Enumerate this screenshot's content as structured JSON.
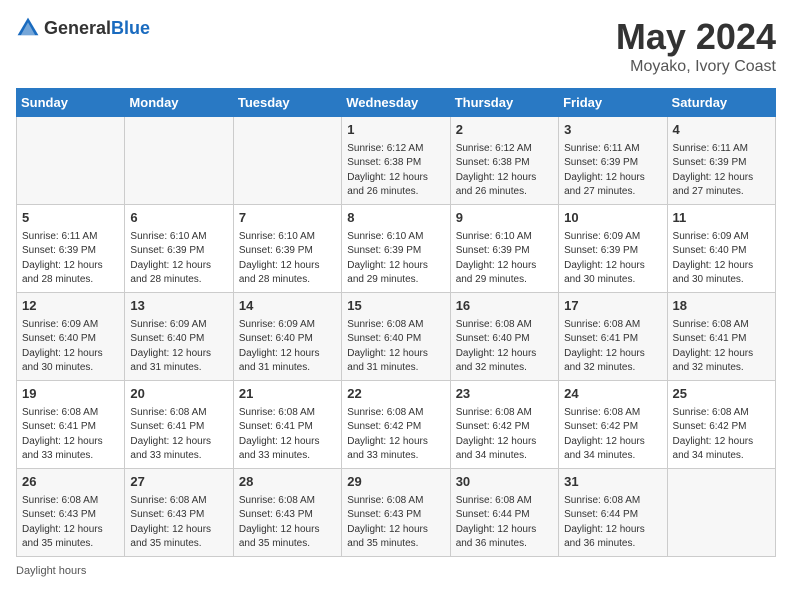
{
  "header": {
    "logo_general": "General",
    "logo_blue": "Blue",
    "title": "May 2024",
    "subtitle": "Moyako, Ivory Coast"
  },
  "days_of_week": [
    "Sunday",
    "Monday",
    "Tuesday",
    "Wednesday",
    "Thursday",
    "Friday",
    "Saturday"
  ],
  "weeks": [
    [
      {
        "day": "",
        "info": ""
      },
      {
        "day": "",
        "info": ""
      },
      {
        "day": "",
        "info": ""
      },
      {
        "day": "1",
        "info": "Sunrise: 6:12 AM\nSunset: 6:38 PM\nDaylight: 12 hours and 26 minutes."
      },
      {
        "day": "2",
        "info": "Sunrise: 6:12 AM\nSunset: 6:38 PM\nDaylight: 12 hours and 26 minutes."
      },
      {
        "day": "3",
        "info": "Sunrise: 6:11 AM\nSunset: 6:39 PM\nDaylight: 12 hours and 27 minutes."
      },
      {
        "day": "4",
        "info": "Sunrise: 6:11 AM\nSunset: 6:39 PM\nDaylight: 12 hours and 27 minutes."
      }
    ],
    [
      {
        "day": "5",
        "info": "Sunrise: 6:11 AM\nSunset: 6:39 PM\nDaylight: 12 hours and 28 minutes."
      },
      {
        "day": "6",
        "info": "Sunrise: 6:10 AM\nSunset: 6:39 PM\nDaylight: 12 hours and 28 minutes."
      },
      {
        "day": "7",
        "info": "Sunrise: 6:10 AM\nSunset: 6:39 PM\nDaylight: 12 hours and 28 minutes."
      },
      {
        "day": "8",
        "info": "Sunrise: 6:10 AM\nSunset: 6:39 PM\nDaylight: 12 hours and 29 minutes."
      },
      {
        "day": "9",
        "info": "Sunrise: 6:10 AM\nSunset: 6:39 PM\nDaylight: 12 hours and 29 minutes."
      },
      {
        "day": "10",
        "info": "Sunrise: 6:09 AM\nSunset: 6:39 PM\nDaylight: 12 hours and 30 minutes."
      },
      {
        "day": "11",
        "info": "Sunrise: 6:09 AM\nSunset: 6:40 PM\nDaylight: 12 hours and 30 minutes."
      }
    ],
    [
      {
        "day": "12",
        "info": "Sunrise: 6:09 AM\nSunset: 6:40 PM\nDaylight: 12 hours and 30 minutes."
      },
      {
        "day": "13",
        "info": "Sunrise: 6:09 AM\nSunset: 6:40 PM\nDaylight: 12 hours and 31 minutes."
      },
      {
        "day": "14",
        "info": "Sunrise: 6:09 AM\nSunset: 6:40 PM\nDaylight: 12 hours and 31 minutes."
      },
      {
        "day": "15",
        "info": "Sunrise: 6:08 AM\nSunset: 6:40 PM\nDaylight: 12 hours and 31 minutes."
      },
      {
        "day": "16",
        "info": "Sunrise: 6:08 AM\nSunset: 6:40 PM\nDaylight: 12 hours and 32 minutes."
      },
      {
        "day": "17",
        "info": "Sunrise: 6:08 AM\nSunset: 6:41 PM\nDaylight: 12 hours and 32 minutes."
      },
      {
        "day": "18",
        "info": "Sunrise: 6:08 AM\nSunset: 6:41 PM\nDaylight: 12 hours and 32 minutes."
      }
    ],
    [
      {
        "day": "19",
        "info": "Sunrise: 6:08 AM\nSunset: 6:41 PM\nDaylight: 12 hours and 33 minutes."
      },
      {
        "day": "20",
        "info": "Sunrise: 6:08 AM\nSunset: 6:41 PM\nDaylight: 12 hours and 33 minutes."
      },
      {
        "day": "21",
        "info": "Sunrise: 6:08 AM\nSunset: 6:41 PM\nDaylight: 12 hours and 33 minutes."
      },
      {
        "day": "22",
        "info": "Sunrise: 6:08 AM\nSunset: 6:42 PM\nDaylight: 12 hours and 33 minutes."
      },
      {
        "day": "23",
        "info": "Sunrise: 6:08 AM\nSunset: 6:42 PM\nDaylight: 12 hours and 34 minutes."
      },
      {
        "day": "24",
        "info": "Sunrise: 6:08 AM\nSunset: 6:42 PM\nDaylight: 12 hours and 34 minutes."
      },
      {
        "day": "25",
        "info": "Sunrise: 6:08 AM\nSunset: 6:42 PM\nDaylight: 12 hours and 34 minutes."
      }
    ],
    [
      {
        "day": "26",
        "info": "Sunrise: 6:08 AM\nSunset: 6:43 PM\nDaylight: 12 hours and 35 minutes."
      },
      {
        "day": "27",
        "info": "Sunrise: 6:08 AM\nSunset: 6:43 PM\nDaylight: 12 hours and 35 minutes."
      },
      {
        "day": "28",
        "info": "Sunrise: 6:08 AM\nSunset: 6:43 PM\nDaylight: 12 hours and 35 minutes."
      },
      {
        "day": "29",
        "info": "Sunrise: 6:08 AM\nSunset: 6:43 PM\nDaylight: 12 hours and 35 minutes."
      },
      {
        "day": "30",
        "info": "Sunrise: 6:08 AM\nSunset: 6:44 PM\nDaylight: 12 hours and 36 minutes."
      },
      {
        "day": "31",
        "info": "Sunrise: 6:08 AM\nSunset: 6:44 PM\nDaylight: 12 hours and 36 minutes."
      },
      {
        "day": "",
        "info": ""
      }
    ]
  ],
  "footer": {
    "note": "Daylight hours"
  }
}
